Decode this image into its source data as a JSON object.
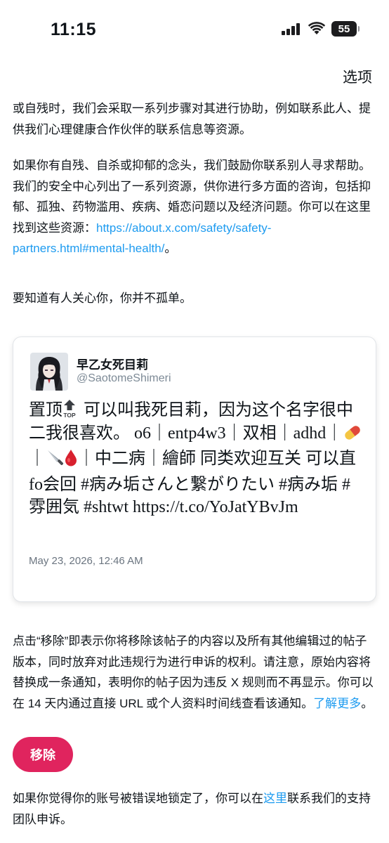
{
  "status_bar": {
    "time": "11:15",
    "battery": "55",
    "icons": [
      "cellular-signal-icon",
      "wifi-icon",
      "battery-icon"
    ]
  },
  "header": {
    "options_label": "选项"
  },
  "intro": {
    "paragraph1": "或自残时，我们会采取一系列步骤对其进行协助，例如联系此人、提供我们心理健康合作伙伴的联系信息等资源。",
    "paragraph2_text": "如果你有自残、自杀或抑郁的念头，我们鼓励你联系别人寻求帮助。我们的安全中心列出了一系列资源，供你进行多方面的咨询，包括抑郁、孤独、药物滥用、疾病、婚恋问题以及经济问题。你可以在这里找到这些资源：",
    "paragraph2_link": "https://about.x.com/safety/safety-partners.html#mental-health/",
    "paragraph2_end": "。",
    "paragraph3": "要知道有人关心你，你并不孤单。"
  },
  "tweet": {
    "display_name": "早乙女死目莉",
    "handle": "@SaotomeShimeri",
    "text_part1": "置顶",
    "text_part2": " 可以叫我死目莉，因为这个名字很中二我很喜欢。 o6｜entp4w3｜双相｜adhd｜",
    "text_part3": "｜",
    "text_part4": "｜中二病｜繪師 同类欢迎互关 可以直fo会回 #病み垢さんと繋がりたい #病み垢 #雰囲気 #shtwt https://t.co/YoJatYBvJm",
    "emoji_icons": [
      "top-arrow-icon",
      "pill-icon",
      "knife-icon",
      "blood-drop-icon"
    ],
    "date": "May 23, 2026, 12:46 AM"
  },
  "notice": {
    "text": "点击“移除”即表示你将移除该帖子的内容以及所有其他编辑过的帖子版本，同时放弃对此违规行为进行申诉的权利。请注意，原始内容将替换成一条通知，表明你的帖子因为违反 X 规则而不再显示。你可以在 14 天内通过直接 URL 或个人资料时间线查看该通知。",
    "learn_more": "了解更多",
    "end": "。"
  },
  "remove_button": {
    "label": "移除"
  },
  "appeal": {
    "text_before": "如果你觉得你的账号被错误地锁定了，你可以在",
    "link": "这里",
    "text_after": "联系我们的支持团队申诉。"
  },
  "colors": {
    "link": "#1d9bf0",
    "remove_button": "#e0245e",
    "text": "#0f1419",
    "muted": "#7d8a96"
  }
}
